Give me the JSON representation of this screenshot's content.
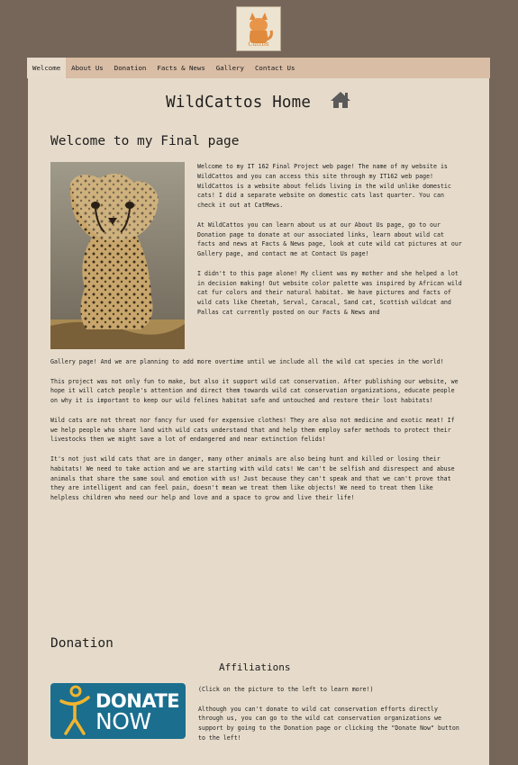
{
  "logo": {
    "text": "Cattos"
  },
  "nav": {
    "items": [
      "Welcome",
      "About Us",
      "Donation",
      "Facts & News",
      "Gallery",
      "Contact Us"
    ],
    "active": "Welcome"
  },
  "page": {
    "title": "WildCattos Home",
    "title_icon": "home-icon"
  },
  "welcome": {
    "heading": "Welcome to my Final page",
    "image": "cheetah-cub-photo",
    "paragraphs": [
      "Welcome to my IT 162 Final Project web page! The name of my website is WildCattos and you can access this site through my IT162 web page! WildCattos is a website about felids living in the wild unlike domestic cats! I did a separate website on domestic cats last quarter. You can check it out at CatMews.",
      "At WildCattos you can learn about us at our About Us page, go to our Donation page to donate at our associated links, learn about wild cat facts and news at Facts & News page, look at cute wild cat pictures at our Gallery page, and contact me at Contact Us page!"
    ],
    "p3_right": "I didn't to this page alone! My client was my mother and she helped a lot in decision making! Out website color palette was inspired by African wild cat fur colors and their natural habitat. We have pictures and facts of wild cats like Cheetah, Serval, Caracal, Sand cat, Scottish wildcat and Pallas cat currently posted on our Facts & News and",
    "p3_full": "Gallery page! And we are planning to add more overtime until we include all the wild cat species in the world!",
    "paragraphs_full": [
      "This project was not only fun to make, but also it support wild cat conservation. After publishing our website, we hope it will catch people's attention and direct them towards wild cat conservation organizations, educate people on why it is important to keep our wild felines habitat safe and untouched and restore their lost habitats!",
      "Wild cats are not threat nor fancy fur used for expensive clothes! They are also not medicine and exotic meat! If we help people who share land with wild cats understand that and help them employ safer methods to protect their livestocks then we might save a lot of endangered and near extinction felids!",
      "It's not just wild cats that are in danger, many other animals are also being hunt and killed or losing their habitats! We need to take action and we are starting with wild cats! We can't be selfish and disrespect and abuse animals that share the same soul and emotion with us! Just because they can't speak and that we can't prove that they are intelligent and can feel pain, doesn't mean we treat them like objects! We need to treat them like helpless children who need our help and love and a space to grow and live their life!"
    ]
  },
  "donation": {
    "heading": "Donation",
    "affiliations": "Affiliations",
    "button_line1": "DONATE",
    "button_line2": "NOW",
    "paragraphs": [
      "(Click on the picture to the left to learn more!)",
      "Although you can't donate to wild cat conservation efforts directly through us, you can go to the wild cat conservation organizations we support by going to the Donation page or clicking the \"Donate Now\" button to the left!"
    ]
  },
  "colors": {
    "background": "#756659",
    "nav": "#d9bda5",
    "page": "#e6dbca",
    "donate": "#1b6e8e"
  }
}
